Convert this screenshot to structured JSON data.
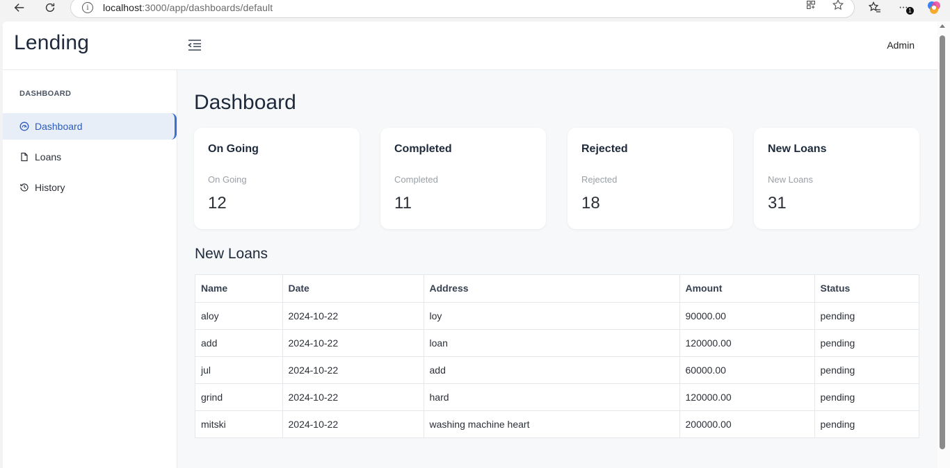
{
  "browser": {
    "url_host": "localhost",
    "url_path": ":3000/app/dashboards/default",
    "notification_count": "1"
  },
  "topbar": {
    "brand": "Lending",
    "user": "Admin"
  },
  "sidebar": {
    "heading": "DASHBOARD",
    "items": [
      {
        "label": "Dashboard",
        "icon": "dashboard-icon",
        "active": true
      },
      {
        "label": "Loans",
        "icon": "file-icon",
        "active": false
      },
      {
        "label": "History",
        "icon": "history-icon",
        "active": false
      }
    ]
  },
  "main": {
    "title": "Dashboard",
    "cards": [
      {
        "title": "On Going",
        "label": "On Going",
        "value": "12"
      },
      {
        "title": "Completed",
        "label": "Completed",
        "value": "11"
      },
      {
        "title": "Rejected",
        "label": "Rejected",
        "value": "18"
      },
      {
        "title": "New Loans",
        "label": "New Loans",
        "value": "31"
      }
    ],
    "section_title": "New Loans",
    "table": {
      "columns": [
        "Name",
        "Date",
        "Address",
        "Amount",
        "Status"
      ],
      "rows": [
        [
          "aloy",
          "2024-10-22",
          "loy",
          "90000.00",
          "pending"
        ],
        [
          "add",
          "2024-10-22",
          "loan",
          "120000.00",
          "pending"
        ],
        [
          "jul",
          "2024-10-22",
          "add",
          "60000.00",
          "pending"
        ],
        [
          "grind",
          "2024-10-22",
          "hard",
          "120000.00",
          "pending"
        ],
        [
          "mitski",
          "2024-10-22",
          "washing machine heart",
          "200000.00",
          "pending"
        ]
      ]
    }
  },
  "colors": {
    "accent": "#3b6fd4",
    "active_bg": "#e8eef8",
    "heading": "#1e2a3b"
  }
}
